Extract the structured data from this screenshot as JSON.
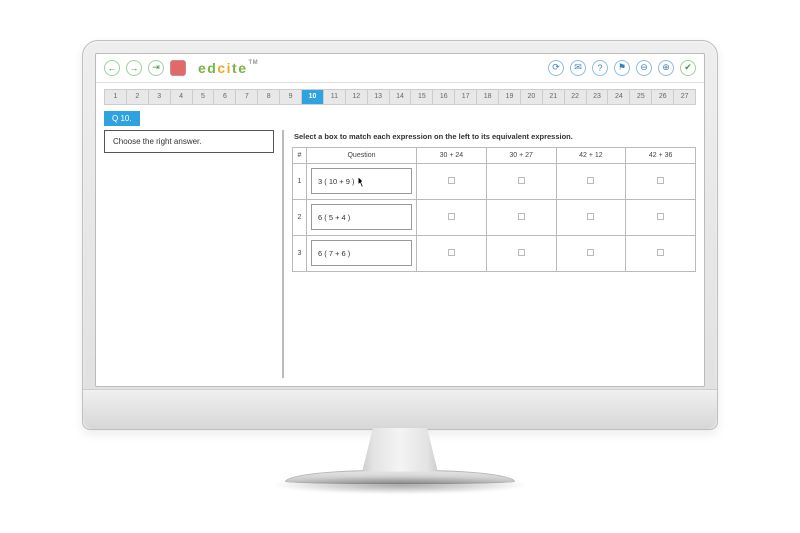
{
  "brand": {
    "text": "edcite",
    "tm": "TM"
  },
  "nav": {
    "count": 27,
    "active": 10
  },
  "question_badge": "Q 10.",
  "left_prompt": "Choose the right answer.",
  "instruction": "Select a box to match each expression on the left to its equivalent expression.",
  "table": {
    "headers": {
      "num": "#",
      "question": "Question",
      "c1": "30 + 24",
      "c2": "30 + 27",
      "c3": "42 + 12",
      "c4": "42 + 36"
    },
    "rows": [
      {
        "n": "1",
        "expr": "3 ( 10 + 9 )"
      },
      {
        "n": "2",
        "expr": "6 ( 5 + 4 )"
      },
      {
        "n": "3",
        "expr": "6 ( 7 + 6 )"
      }
    ]
  },
  "icons": {
    "back": "←",
    "forward": "→",
    "skipend": "⇥",
    "stop": "■",
    "refresh": "⟳",
    "mail": "✉",
    "help": "?",
    "flag": "⚑",
    "zoomout": "⊖",
    "zoomin": "⊕",
    "check": "✔"
  }
}
